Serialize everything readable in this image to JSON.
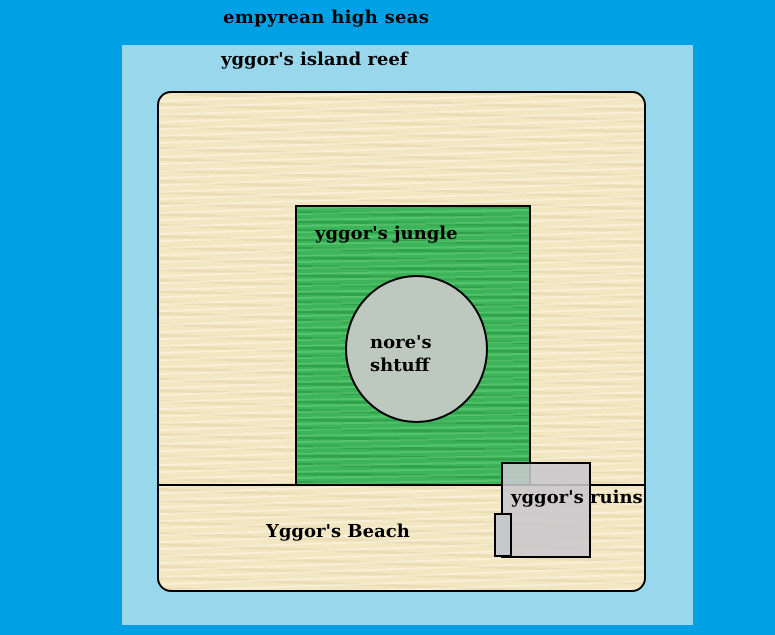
{
  "map": {
    "seas": {
      "label": "empyrean high seas",
      "color": "#00a0e4"
    },
    "reef": {
      "label": "yggor's island reef",
      "color": "#99d8ec"
    },
    "island": {
      "color": "#f3e7c2"
    },
    "jungle": {
      "label": "yggor's jungle",
      "color": "#3cb55a"
    },
    "shtuff": {
      "label": "nore's shtuff",
      "color": "#bdc9bf"
    },
    "ruins": {
      "label": "yggor's ruins",
      "color": "#c8c8cd"
    },
    "beach": {
      "label": "Yggor's Beach"
    }
  }
}
